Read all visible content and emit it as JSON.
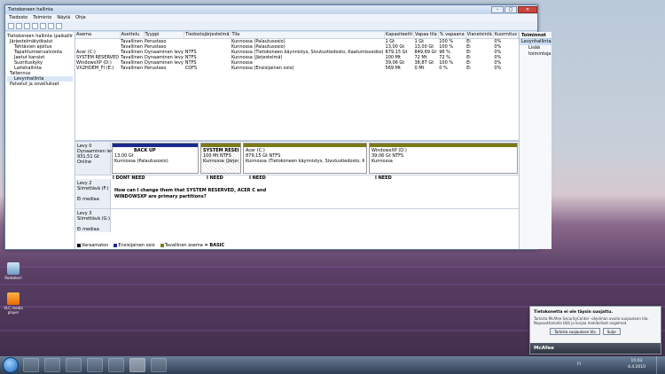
{
  "window": {
    "title": "Tietokoneen hallinta",
    "min": "–",
    "max": "□",
    "close": "✕"
  },
  "menu": [
    "Tiedosto",
    "Toiminto",
    "Näytä",
    "Ohje"
  ],
  "tree": [
    "Tietokoneen hallinta (paikallin",
    "Järjestelmätyökalut",
    "Tehtävien ajoitus",
    "Tapahtumienvalvonta",
    "Jaetut kansiot",
    "Suorituskyky",
    "Laitehallinta",
    "Tallennus",
    "Levynhallinta",
    "Palvelut ja sovellukset"
  ],
  "columns": [
    "Asema",
    "Asettelu",
    "Tyyppi",
    "Tiedostojärjestelmä",
    "Tila",
    "Kapasiteetti",
    "Vapaa tila",
    "% vapaana",
    "Vianetsintä",
    "Kuormitus"
  ],
  "rows": [
    [
      "",
      "Tavallinen",
      "Perustaso",
      "",
      "Kunnossa (Palautusosio)",
      "1 Gt",
      "1 Gt",
      "100 %",
      "Ei",
      "0%"
    ],
    [
      "",
      "Tavallinen",
      "Perustaso",
      "",
      "Kunnossa (Palautusosio)",
      "13,00 Gt",
      "13,00 Gt",
      "100 %",
      "Ei",
      "0%"
    ],
    [
      "Acer (C:)",
      "Tavallinen",
      "Dynaaminen levy",
      "NTFS",
      "Kunnossa (Tietokoneen käynnistys, Sivutustiedosto, Kaatumisvedos)",
      "879,15 Gt",
      "849,69 Gt",
      "96 %",
      "Ei",
      "0%"
    ],
    [
      "SYSTEM RESERVED",
      "Tavallinen",
      "Dynaaminen levy",
      "NTFS",
      "Kunnossa (Järjestelmä)",
      "100 Mt",
      "72 Mt",
      "72 %",
      "Ei",
      "0%"
    ],
    [
      "WindowsXP (D:)",
      "Tavallinen",
      "Dynaaminen levy",
      "NTFS",
      "Kunnossa",
      "39,06 Gt",
      "38,87 Gt",
      "100 %",
      "Ei",
      "0%"
    ],
    [
      "VX2HOEM_FI (E:)",
      "Tavallinen",
      "Perustaso",
      "CDFS",
      "Kunnossa (Ensisijainen osio)",
      "569 Mt",
      "0 Mt",
      "0 %",
      "Ei",
      "0%"
    ]
  ],
  "disk0": {
    "label": "Levy 0",
    "type": "Dynaaminen levy",
    "size": "931,51 Gt",
    "status": "Online"
  },
  "parts0": [
    {
      "name": "BACK UP",
      "size": "13,00 Gt",
      "status": "Kunnossa (Palautusosio)"
    },
    {
      "name": "SYSTEM RESERVED",
      "size": "100 Mt NTFS",
      "status": "Kunnossa (Järjestelmä)"
    },
    {
      "name": "Acer (C:)",
      "size": "879,15 Gt NTFS",
      "status": "Kunnossa (Tietokoneen käynnistys, Sivutustiedosto, Kaatumisvedos)"
    },
    {
      "name": "WindowsXP (D:)",
      "size": "39,06 Gt NTFS",
      "status": "Kunnossa"
    }
  ],
  "needs": [
    "I DONT NEED",
    "I NEED",
    "I NEED",
    "I NEED"
  ],
  "disk2": {
    "label": "Levy 2",
    "type": "Siirrettävä (F:)",
    "status": "Ei mediaa"
  },
  "question": "How can I change them that SYSTEM RESERVED, ACER C and WINDOWSXP are primary partitions?",
  "disk3": {
    "label": "Levy 3",
    "type": "Siirrettävä (G:)",
    "status": "Ei mediaa"
  },
  "legend": [
    "Varaamaton",
    "Ensisijainen osio",
    "Tavallinen asema",
    "= BASIC"
  ],
  "actions": {
    "title": "Toiminnot",
    "section": "Levynhallinta",
    "more": "Lisää toimintoja"
  },
  "desktop": [
    {
      "label": "Roskakori"
    },
    {
      "label": "VLC media player"
    }
  ],
  "notification": {
    "title": "Tietokonetta ei ole täysin suojattu.",
    "body": "Tarkista McAfee SecurityCenter -ohjelman avulla suojauksen tila. Napsauttamalla tätä ja korjaa mahdolliset ongelmat.",
    "btn_fix": "Tarkista suojauksen tila",
    "btn_close": "Sulje",
    "brand": "McAfee"
  },
  "tray": {
    "lang": "FI",
    "time": "15:03",
    "date": "4.4.2010"
  },
  "colors": {
    "primary": "#1a2b8c",
    "dynamic": "#7a7a1a",
    "unalloc": "#111111"
  }
}
